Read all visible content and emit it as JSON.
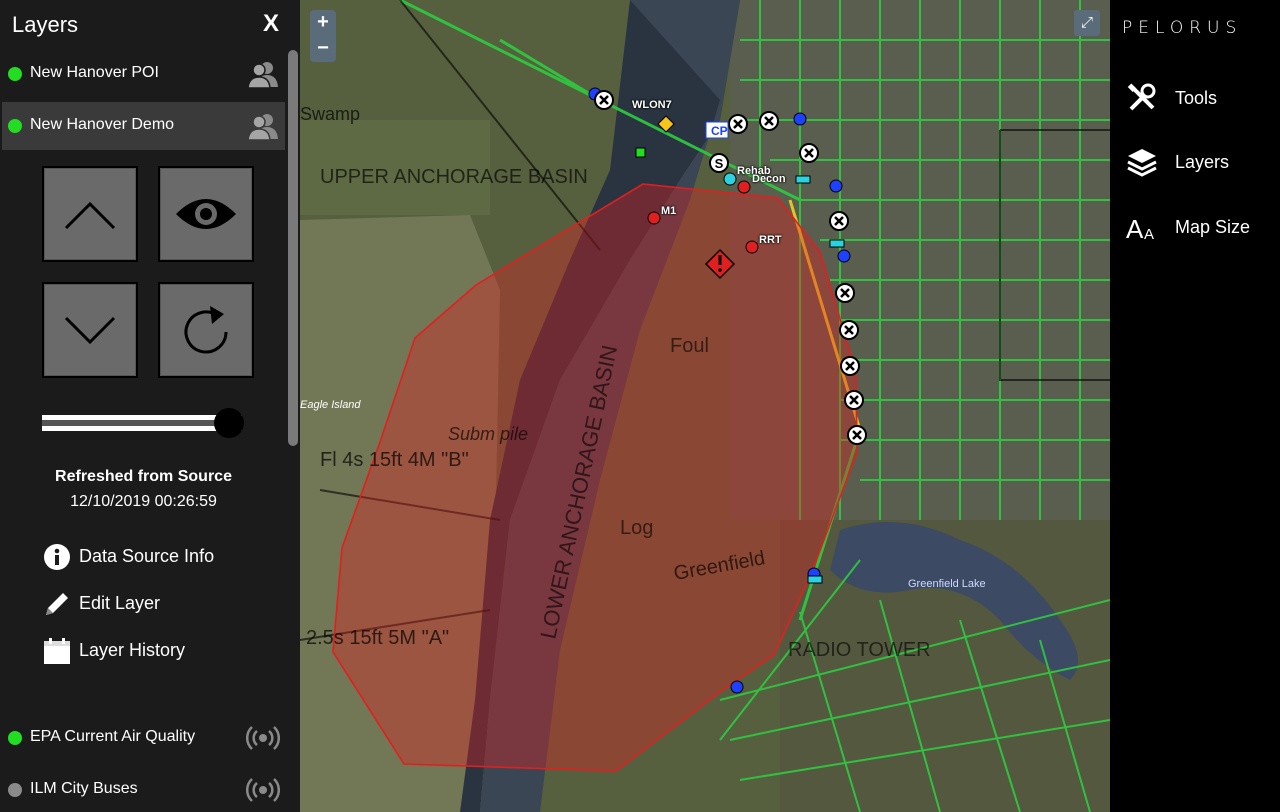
{
  "panel": {
    "title": "Layers",
    "close_label": "X",
    "layers_top": [
      {
        "name": "New Hanover POI",
        "status": "on",
        "kind_icon": "users-icon"
      },
      {
        "name": "New Hanover Demo",
        "status": "on",
        "kind_icon": "users-icon",
        "selected": true
      }
    ],
    "controls": [
      "move-up-icon",
      "eye-icon",
      "move-down-icon",
      "refresh-icon"
    ],
    "opacity": 0.93,
    "refresh_label": "Refreshed from Source",
    "refresh_time": "12/10/2019 00:26:59",
    "actions": [
      {
        "label": "Data Source Info",
        "icon": "info-icon"
      },
      {
        "label": "Edit Layer",
        "icon": "pencil-icon"
      },
      {
        "label": "Layer History",
        "icon": "calendar-icon"
      }
    ],
    "layers_bottom": [
      {
        "name": "EPA Current Air Quality",
        "status": "on",
        "kind_icon": "broadcast-icon"
      },
      {
        "name": "ILM City Buses",
        "status": "off",
        "kind_icon": "broadcast-icon"
      }
    ]
  },
  "map": {
    "zoom_in": "+",
    "zoom_out": "−",
    "expand": "⤢",
    "labels": {
      "wlon7": "WLON7",
      "m1": "M1",
      "rrt": "RRT",
      "rehab": "Rehab",
      "decon": "Decon",
      "cp": "CP"
    },
    "base_text": {
      "upper_basin": "UPPER ANCHORAGE BASIN",
      "lower_basin": "LOWER ANCHORAGE BASIN",
      "swamp": "Swamp",
      "eagle_island": "Eagle Island",
      "subm_pile": "Subm pile",
      "fl4s": "Fl 4s 15ft 4M \"B\"",
      "fl25s": "2.5s 15ft 5M \"A\"",
      "greenfield": "Greenfield",
      "greenfield_lake": "Greenfield Lake",
      "foul": "Foul",
      "log": "Log",
      "radio_tower": "RADIO TOWER"
    },
    "colors": {
      "plume": "#e02020",
      "roads": "#2ecc40"
    }
  },
  "menu": {
    "brand": "PELORUS",
    "items": [
      {
        "label": "Tools",
        "icon": "tools-icon"
      },
      {
        "label": "Layers",
        "icon": "layers-icon"
      },
      {
        "label": "Map Size",
        "icon": "font-size-icon"
      }
    ]
  }
}
